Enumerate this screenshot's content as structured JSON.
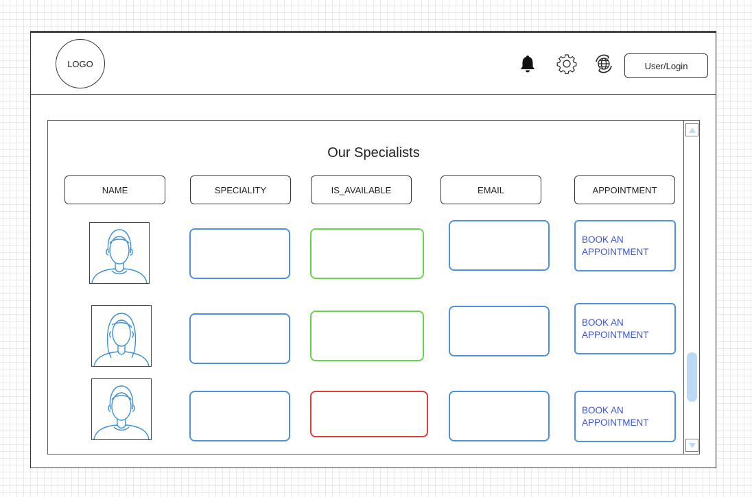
{
  "header": {
    "logo_text": "LOGO",
    "icons": [
      "bell-icon",
      "gear-icon",
      "globe-icon"
    ],
    "login_label": "User/Login"
  },
  "main": {
    "title": "Our Specialists",
    "columns": [
      "NAME",
      "SPECIALITY",
      "IS_AVAILABLE",
      "EMAIL",
      "APPOINTMENT"
    ],
    "rows": [
      {
        "avatar": "male-avatar",
        "availability": "available",
        "action": "BOOK AN APPOINTMENT"
      },
      {
        "avatar": "female-avatar",
        "availability": "available",
        "action": "BOOK AN APPOINTMENT"
      },
      {
        "avatar": "male-avatar",
        "availability": "unavailable",
        "action": "BOOK AN APPOINTMENT"
      }
    ]
  },
  "colors": {
    "field_border": "#4d90e0",
    "available": "#66d44a",
    "unavailable": "#e03c3c",
    "action_text": "#3a55d4",
    "scroll_thumb": "#bcd9f5"
  }
}
